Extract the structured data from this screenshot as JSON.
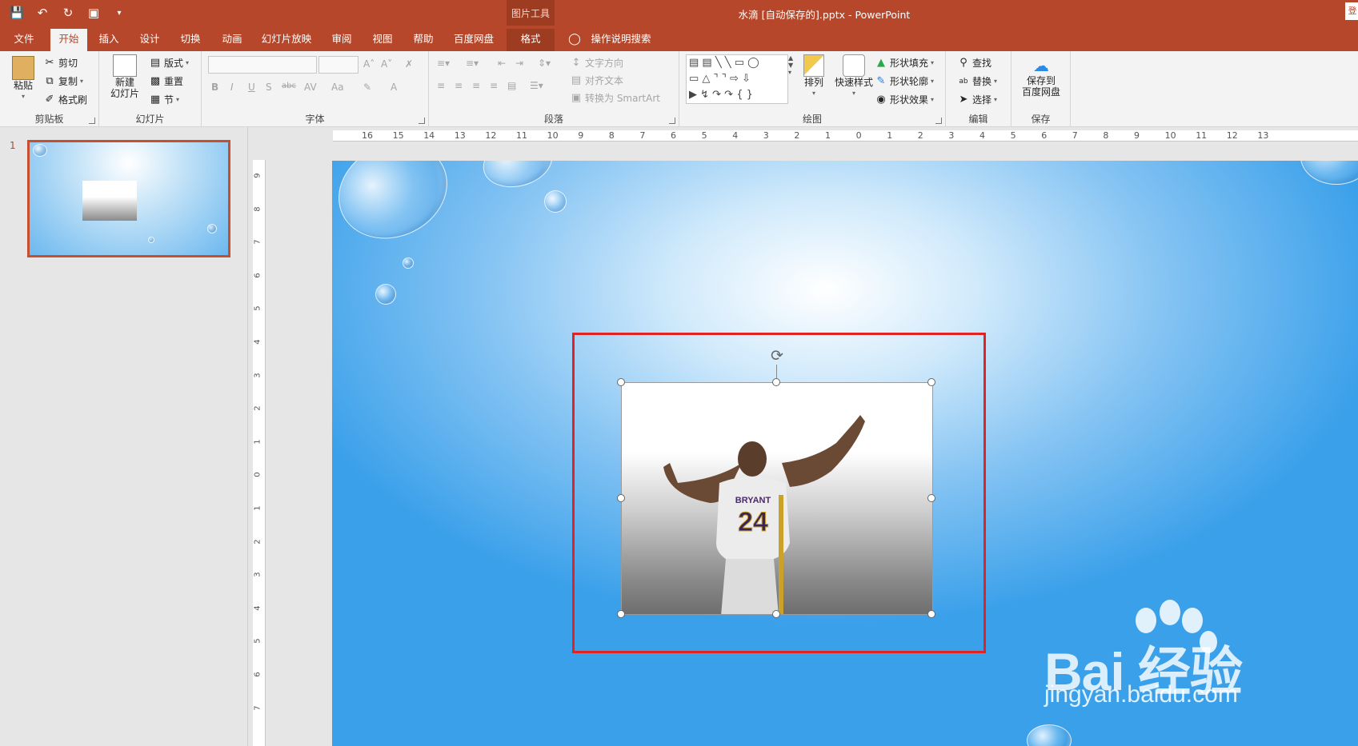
{
  "app": {
    "title": "水滴 [自动保存的].pptx  -  PowerPoint",
    "signin": "登"
  },
  "context_tab_group": "图片工具",
  "tabs": [
    "文件",
    "开始",
    "插入",
    "设计",
    "切换",
    "动画",
    "幻灯片放映",
    "审阅",
    "视图",
    "帮助",
    "百度网盘",
    "格式"
  ],
  "tell_me": "操作说明搜索",
  "ribbon": {
    "clipboard": {
      "label": "剪贴板",
      "paste": "粘贴",
      "cut": "剪切",
      "copy": "复制",
      "format_painter": "格式刷"
    },
    "slides": {
      "label": "幻灯片",
      "new_slide_1": "新建",
      "new_slide_2": "幻灯片",
      "layout": "版式",
      "reset": "重置",
      "section": "节"
    },
    "font": {
      "label": "字体",
      "bold": "B",
      "italic": "I",
      "underline": "U",
      "shadow": "S",
      "strike": "abc",
      "spacing": "AV",
      "case": "Aa",
      "grow": "A˄",
      "shrink": "A˅"
    },
    "paragraph": {
      "label": "段落",
      "text_direction": "文字方向",
      "align_text": "对齐文本",
      "smartart": "转换为 SmartArt"
    },
    "drawing": {
      "label": "绘图",
      "arrange": "排列",
      "quick_styles": "快速样式",
      "shape_fill": "形状填充",
      "shape_outline": "形状轮廓",
      "shape_effects": "形状效果"
    },
    "editing": {
      "label": "编辑",
      "find": "查找",
      "replace": "替换",
      "select": "选择"
    },
    "save": {
      "label": "保存",
      "save_to_1": "保存到",
      "save_to_2": "百度网盘"
    }
  },
  "slide_panel": {
    "number": "1"
  },
  "hruler_ticks": [
    "16",
    "15",
    "14",
    "13",
    "12",
    "11",
    "10",
    "9",
    "8",
    "7",
    "6",
    "5",
    "4",
    "3",
    "2",
    "1",
    "0",
    "1",
    "2",
    "3",
    "4",
    "5",
    "6",
    "7",
    "8",
    "9",
    "10",
    "11",
    "12",
    "13"
  ],
  "vruler_ticks": [
    "9",
    "8",
    "7",
    "6",
    "5",
    "4",
    "3",
    "2",
    "1",
    "0",
    "1",
    "2",
    "3",
    "4",
    "5",
    "6",
    "7"
  ],
  "picture": {
    "jersey_name": "BRYANT",
    "jersey_number": "24"
  },
  "watermark": {
    "main": "Bai 经验",
    "sub": "jingyan.baidu.com"
  }
}
